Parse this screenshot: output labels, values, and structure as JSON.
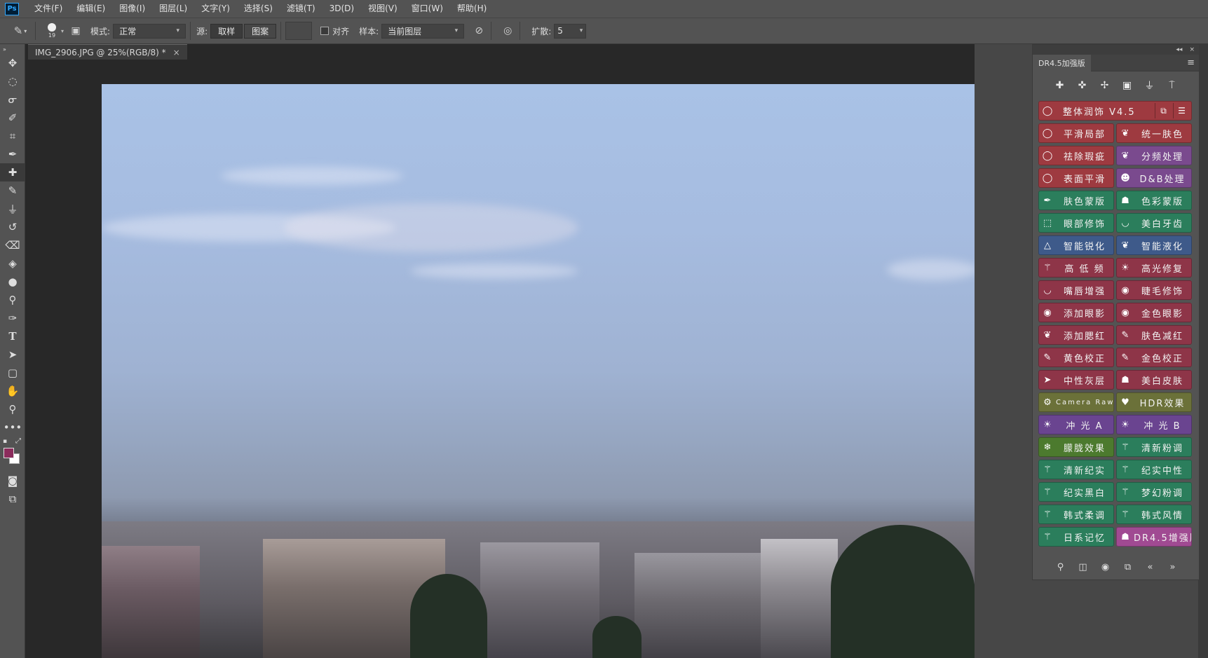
{
  "app": {
    "logo": "Ps",
    "menu": [
      "文件(F)",
      "编辑(E)",
      "图像(I)",
      "图层(L)",
      "文字(Y)",
      "选择(S)",
      "滤镜(T)",
      "3D(D)",
      "视图(V)",
      "窗口(W)",
      "帮助(H)"
    ]
  },
  "options": {
    "brush_size": "19",
    "mode_label": "模式:",
    "mode_value": "正常",
    "source_label": "源:",
    "source_sampled": "取样",
    "source_pattern": "图案",
    "align_label": "对齐",
    "sample_label": "样本:",
    "sample_value": "当前图层",
    "diffusion_label": "扩散:",
    "diffusion_value": "5"
  },
  "document": {
    "tab_title": "IMG_2906.JPG @ 25%(RGB/8) *",
    "close_glyph": "×"
  },
  "colors": {
    "foreground": "#8b2c5c",
    "background": "#ffffff"
  },
  "panel": {
    "tab": "DR4.5加强版",
    "menu_glyph": "≡",
    "collapse_glyph": "◂◂",
    "close_glyph": "×",
    "main_button": "整体润饰  V4.5",
    "buttons": [
      {
        "label": "平滑局部",
        "icon": "lasso-icon",
        "color": "#9e3a40"
      },
      {
        "label": "统一肤色",
        "icon": "feather-icon",
        "color": "#9e3a40"
      },
      {
        "label": "祛除瑕疵",
        "icon": "lasso-icon",
        "color": "#7a4a8e"
      },
      {
        "label": "分频处理",
        "icon": "feather-icon",
        "color": "#7a4a8e"
      },
      {
        "label": "表面平滑",
        "icon": "lasso-icon",
        "color": "#7a4a8e"
      },
      {
        "label": "D&B处理",
        "icon": "face-icon",
        "color": "#7a4a8e"
      },
      {
        "label": "肤色蒙版",
        "icon": "dropper-icon",
        "color": "#2b7e5c"
      },
      {
        "label": "色彩蒙版",
        "icon": "mask-icon",
        "color": "#2b7e5c"
      },
      {
        "label": "眼部修饰",
        "icon": "marquee-icon",
        "color": "#2b7e5c"
      },
      {
        "label": "美白牙齿",
        "icon": "lips-icon",
        "color": "#2b7e5c"
      },
      {
        "label": "智能锐化",
        "icon": "triangle-icon",
        "color": "#3e5a8a"
      },
      {
        "label": "智能液化",
        "icon": "feather-icon",
        "color": "#3e5a8a"
      },
      {
        "label": "高 低 频",
        "icon": "wand-icon",
        "color": "#8e3548"
      },
      {
        "label": "高光修复",
        "icon": "sun-icon",
        "color": "#8e3548"
      },
      {
        "label": "嘴唇增强",
        "icon": "lips-icon",
        "color": "#8e3548"
      },
      {
        "label": "睫毛修饰",
        "icon": "eye-icon",
        "color": "#8e3548"
      },
      {
        "label": "添加眼影",
        "icon": "eye-icon",
        "color": "#8e3548"
      },
      {
        "label": "金色眼影",
        "icon": "eye-icon",
        "color": "#8e3548"
      },
      {
        "label": "添加腮红",
        "icon": "feather-icon",
        "color": "#8e3548"
      },
      {
        "label": "肤色减红",
        "icon": "brush-icon",
        "color": "#8e3548"
      },
      {
        "label": "黄色校正",
        "icon": "brush-icon",
        "color": "#8e3548"
      },
      {
        "label": "金色校正",
        "icon": "brush-icon",
        "color": "#8e3548"
      },
      {
        "label": "中性灰层",
        "icon": "cursor-icon",
        "color": "#8e3548"
      },
      {
        "label": "美白皮肤",
        "icon": "mask-icon",
        "color": "#8e3548"
      },
      {
        "label": "Camera Raw",
        "icon": "gear-icon",
        "color": "#6b7139"
      },
      {
        "label": "HDR效果",
        "icon": "heart-icon",
        "color": "#6b7139"
      },
      {
        "label": "冲 光 A",
        "icon": "sun-icon",
        "color": "#6a4490"
      },
      {
        "label": "冲 光 B",
        "icon": "sun-icon",
        "color": "#6a4490"
      },
      {
        "label": "朦胧效果",
        "icon": "snowflake-icon",
        "color": "#4c7a2e"
      },
      {
        "label": "清新粉调",
        "icon": "wand-icon",
        "color": "#2b7e5c"
      },
      {
        "label": "清新纪实",
        "icon": "wand-icon",
        "color": "#2b7e5c"
      },
      {
        "label": "纪实中性",
        "icon": "wand-icon",
        "color": "#2b7e5c"
      },
      {
        "label": "纪实黑白",
        "icon": "wand-icon",
        "color": "#2b7e5c"
      },
      {
        "label": "梦幻粉调",
        "icon": "wand-icon",
        "color": "#2b7e5c"
      },
      {
        "label": "韩式柔调",
        "icon": "wand-icon",
        "color": "#2b7e5c"
      },
      {
        "label": "韩式风情",
        "icon": "wand-icon",
        "color": "#2b7e5c"
      },
      {
        "label": "日系记忆",
        "icon": "wand-icon",
        "color": "#2b7e5c"
      },
      {
        "label": "DR4.5增强版",
        "icon": "people-icon",
        "color": "#a04a92"
      }
    ]
  }
}
